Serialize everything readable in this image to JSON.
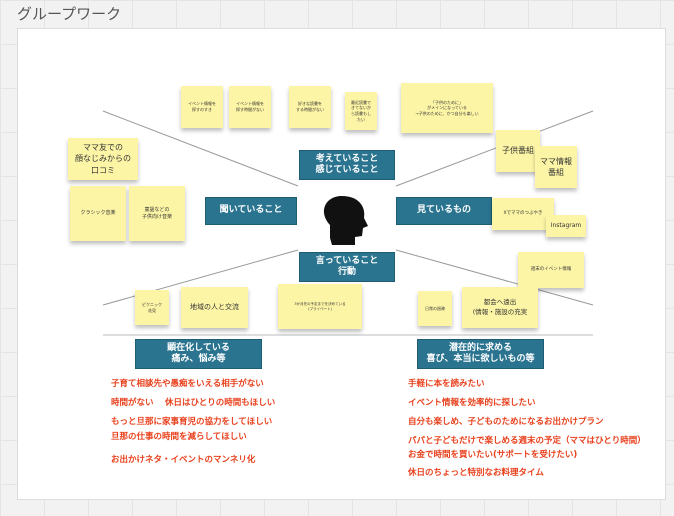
{
  "title": "グループワーク",
  "center": {
    "think": "考えていること\n感じていること",
    "hear": "聞いていること",
    "see": "見ているもの",
    "say": "言っていること\n行動"
  },
  "bottom": {
    "pain": "顕在化している\n痛み、悩み等",
    "gain": "潜在的に求める\n喜び、本当に欲しいもの等"
  },
  "stickies": {
    "t1": "イベント情報を\n探すのすき",
    "t2": "イベント情報を\n探す時間がない",
    "t3": "好きな読書を\nする時間がない",
    "t4": "最近読書で\nきてないか\nら読書もし\nたい",
    "t5": "「子供のために」\nがメインになっている\n→子供のために、かつ自分も楽しい",
    "h1": "ママ友での\n顔なじみからの\n口コミ",
    "h2": "クラシック音楽",
    "h3": "童謡などの\n子供向け音楽",
    "s1": "子供番組",
    "s2": "ママ情報\n番組",
    "s3": "Xでママのつぶやき",
    "s4": "Instagram",
    "s5": "週末のイベント情報",
    "d1": "ピクニック\n花見",
    "d2": "地域の人と交流",
    "d3": "3か月先の予定までを決めている\n(プライベート)",
    "d4": "日常の過疎",
    "d5": "都会へ遠出\n(情報・施設の充実"
  },
  "pains": [
    "子育て相談先や愚痴をいえる相手がない",
    "時間がない　 休日はひとりの時間もほしい",
    "もっと旦那に家事育児の協力をしてほしい",
    "旦那の仕事の時間を減らしてほしい",
    "お出かけネタ・イベントのマンネリ化"
  ],
  "gains": [
    "手軽に本を読みたい",
    "イベント情報を効率的に探したい",
    "自分も楽しめ、子どものためになるお出かけプラン",
    "パパと子どもだけで楽しめる週末の予定（ママはひとり時間）",
    "お金で時間を買いたい(サポートを受けたい)",
    "休日のちょっと特別なお料理タイム"
  ],
  "colors": {
    "accent": "#2a7490",
    "sticky": "#fdf5a6",
    "text_red": "#e8401c"
  }
}
